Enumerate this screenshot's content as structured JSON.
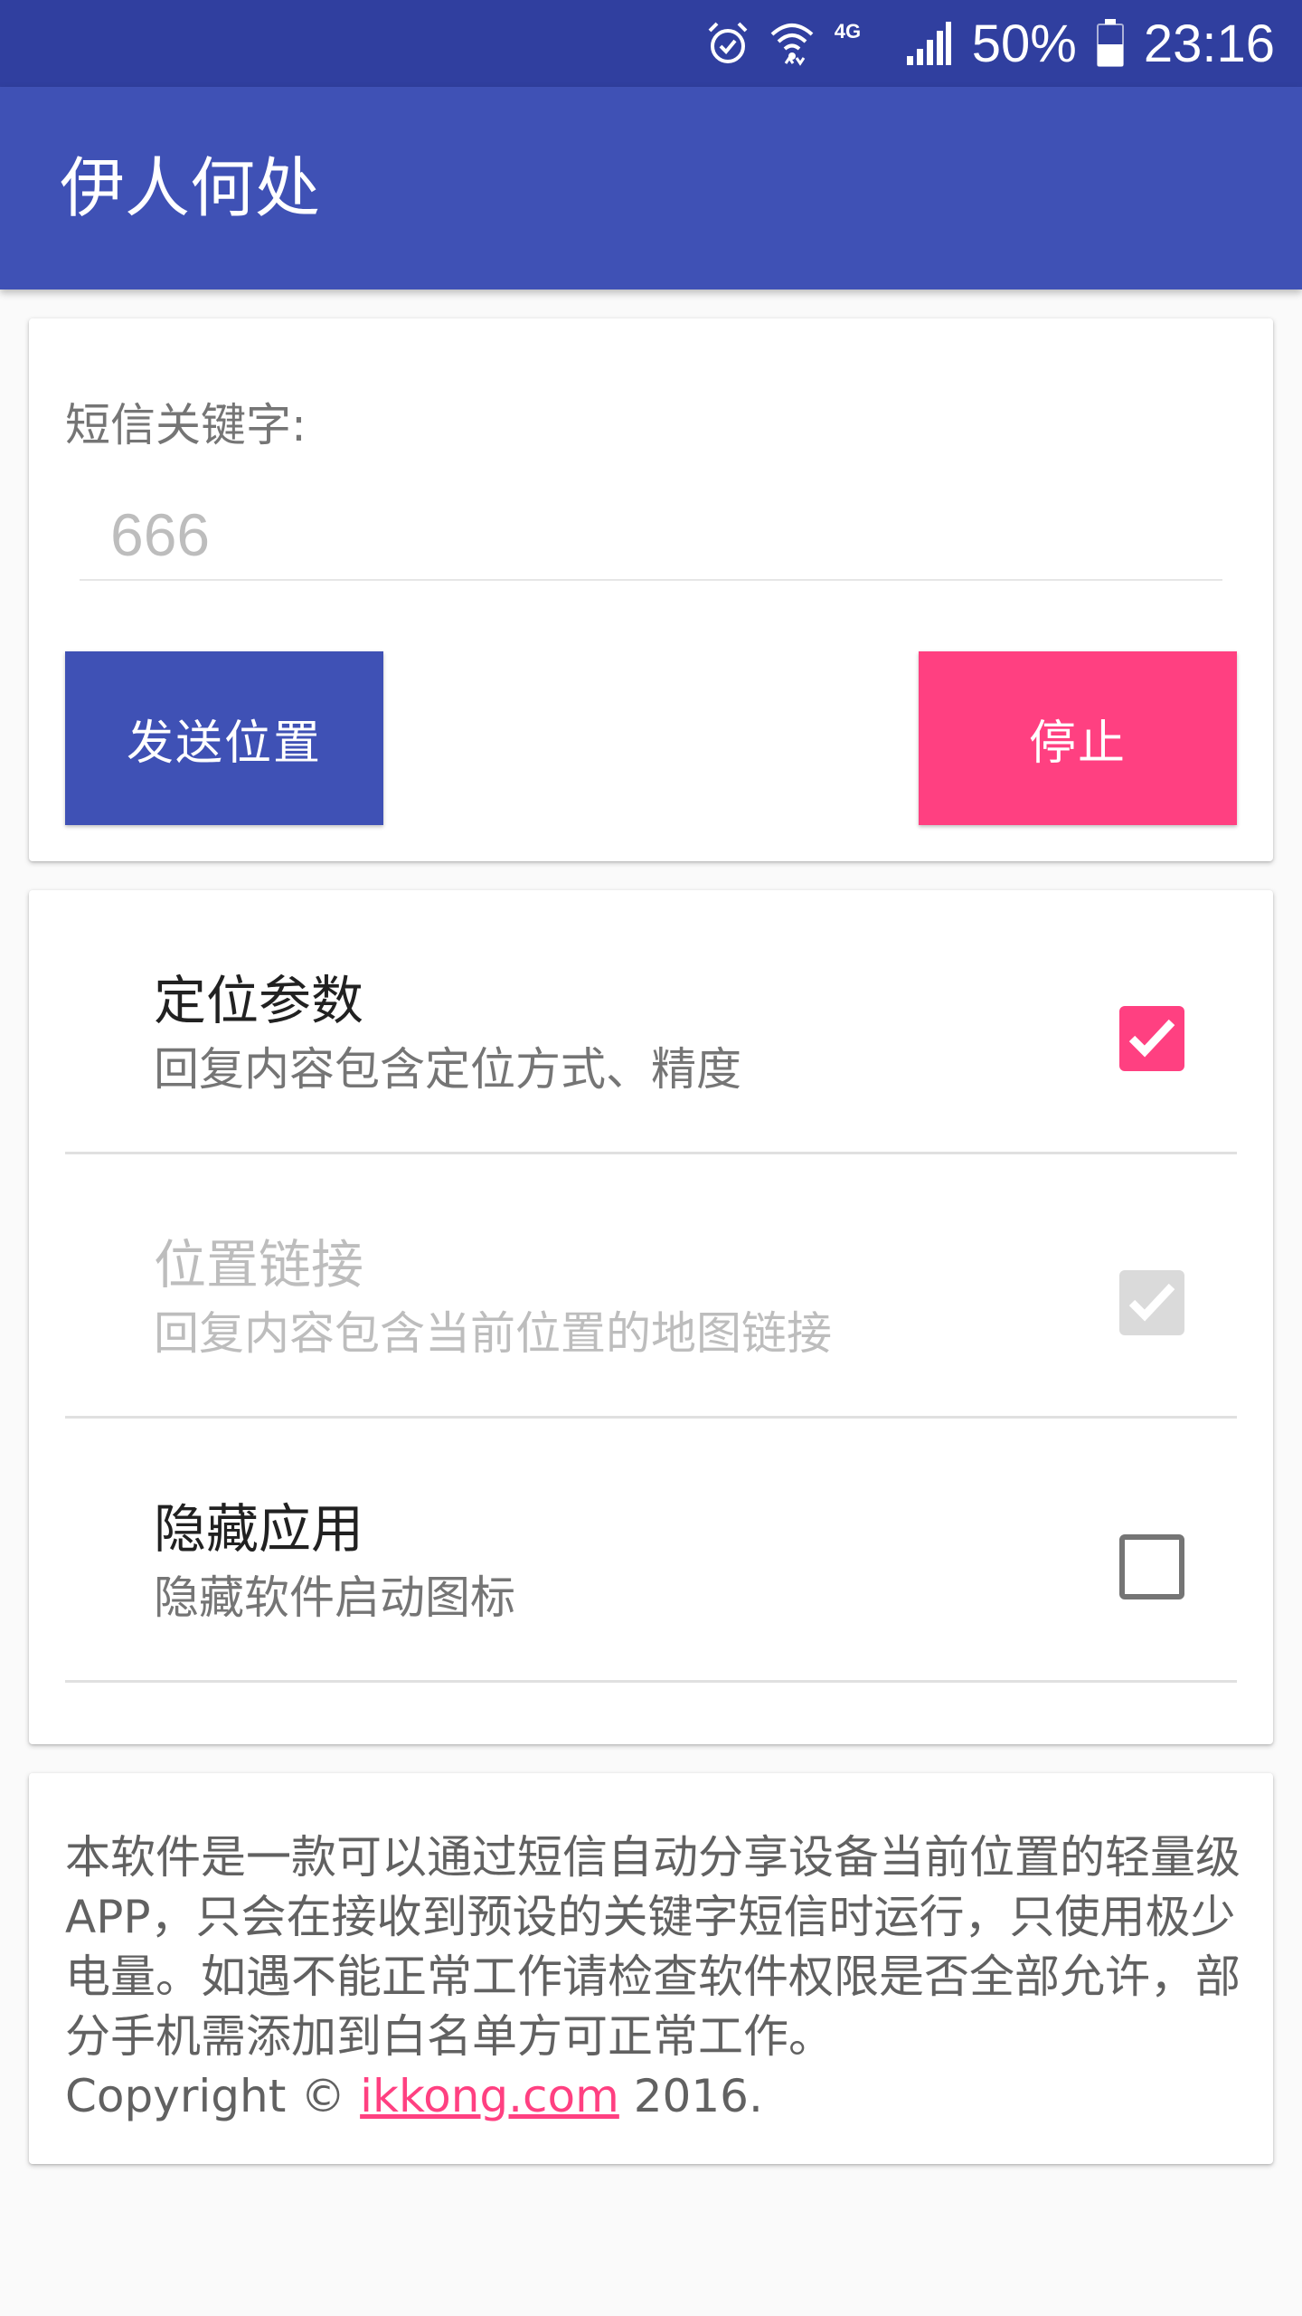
{
  "status_bar": {
    "battery": "50%",
    "time": "23:16",
    "network": "4G",
    "icons": [
      "alarm-icon",
      "wifi-icon",
      "cellular-signal-icon",
      "battery-icon"
    ]
  },
  "app_bar": {
    "title": "伊人何处"
  },
  "keyword_card": {
    "label": "短信关键字:",
    "input_placeholder": "666",
    "send_button": "发送位置",
    "stop_button": "停止"
  },
  "settings": {
    "items": [
      {
        "title": "定位参数",
        "summary": "回复内容包含定位方式、精度",
        "checked": true,
        "enabled": true
      },
      {
        "title": "位置链接",
        "summary": "回复内容包含当前位置的地图链接",
        "checked": true,
        "enabled": false
      },
      {
        "title": "隐藏应用",
        "summary": "隐藏软件启动图标",
        "checked": false,
        "enabled": true
      }
    ]
  },
  "about": {
    "text": "本软件是一款可以通过短信自动分享设备当前位置的轻量级APP，只会在接收到预设的关键字短信时运行，只使用极少电量。如遇不能正常工作请检查软件权限是否全部允许，部分手机需添加到白名单方可正常工作。",
    "copyright_prefix": "Copyright © ",
    "link_text": "ikkong.com",
    "copyright_suffix": " 2016."
  },
  "colors": {
    "primary": "#3F51B5",
    "primary_dark": "#303F9F",
    "accent": "#FF4081",
    "background": "#FAFAFA"
  }
}
